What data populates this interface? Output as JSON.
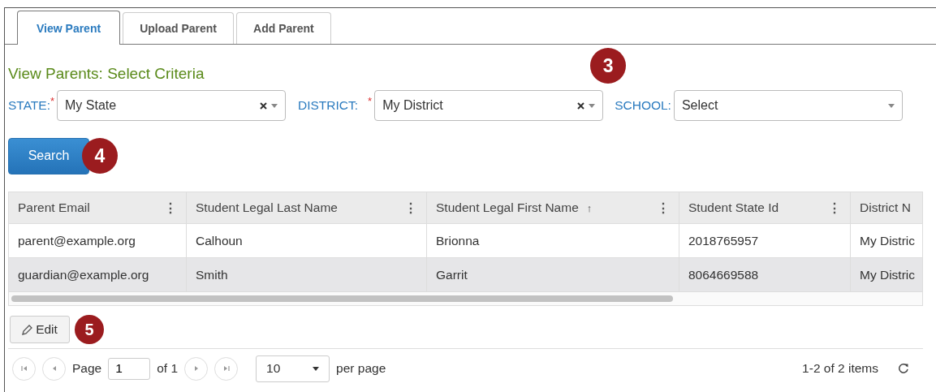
{
  "tabs": [
    {
      "label": "View Parent",
      "selected": true
    },
    {
      "label": "Upload Parent",
      "selected": false
    },
    {
      "label": "Add Parent",
      "selected": false
    }
  ],
  "heading": "View Parents: Select Criteria",
  "filters": [
    {
      "label": "STATE:",
      "required_mark": "*",
      "value": "My State",
      "clearable": true
    },
    {
      "label": "DISTRICT:",
      "required_mark": "*",
      "value": "My District",
      "clearable": true
    },
    {
      "label": "SCHOOL:",
      "placeholder": "Select",
      "clearable": false
    }
  ],
  "callouts": [
    "3",
    "4",
    "5"
  ],
  "search_button": "Search",
  "table": {
    "columns": [
      {
        "label": "Parent Email",
        "menu": "⋮"
      },
      {
        "label": "Student Legal Last Name",
        "menu": "⋮"
      },
      {
        "label": "Student Legal First Name",
        "sort": "↑",
        "menu": "⋮"
      },
      {
        "label": "Student State Id",
        "menu": "⋮"
      },
      {
        "label": "District N"
      }
    ],
    "rows": [
      {
        "selected": false,
        "cells": [
          "parent@example.org",
          "Calhoun",
          "Brionna",
          "2018765957",
          "My Distric"
        ]
      },
      {
        "selected": true,
        "cells": [
          "guardian@example.org",
          "Smith",
          "Garrit",
          "8064669588",
          "My Distric"
        ]
      }
    ]
  },
  "edit_button": "Edit",
  "pager": {
    "page_label": "Page",
    "page": "1",
    "of": "of 1",
    "page_size": "10",
    "per_page": "per page",
    "summary": "1-2 of 2 items"
  }
}
